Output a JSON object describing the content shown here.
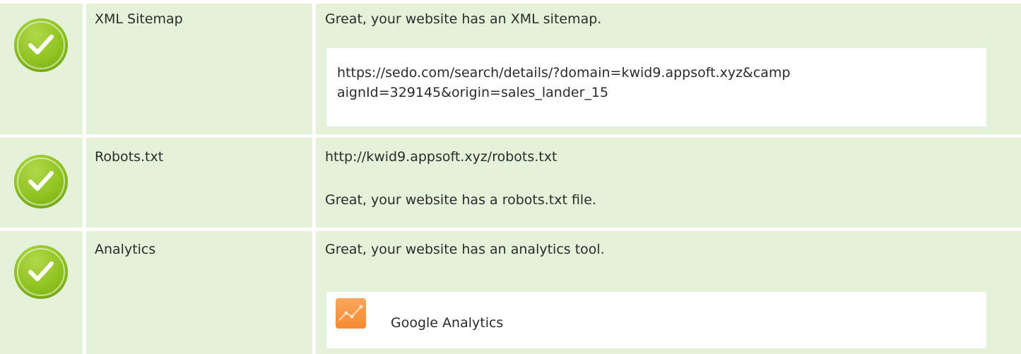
{
  "rows": [
    {
      "status_icon": "check-circle-icon",
      "label": "XML Sitemap",
      "message": "Great, your website has an XML sitemap.",
      "sitemap_url_line1": "https://sedo.com/search/details/?domain=kwid9.appsoft.xyz&camp",
      "sitemap_url_line2": "aignId=329145&origin=sales_lander_15"
    },
    {
      "status_icon": "check-circle-icon",
      "label": "Robots.txt",
      "robots_url": "http://kwid9.appsoft.xyz/robots.txt",
      "message": "Great, your website has a robots.txt file."
    },
    {
      "status_icon": "check-circle-icon",
      "label": "Analytics",
      "message": "Great, your website has an analytics tool.",
      "tools": [
        {
          "icon": "google-analytics-icon",
          "name": "Google Analytics"
        }
      ]
    }
  ],
  "colors": {
    "row_background": "#e4f2d9",
    "check_green": "#8dc21f",
    "analytics_orange": "#f68a31"
  }
}
